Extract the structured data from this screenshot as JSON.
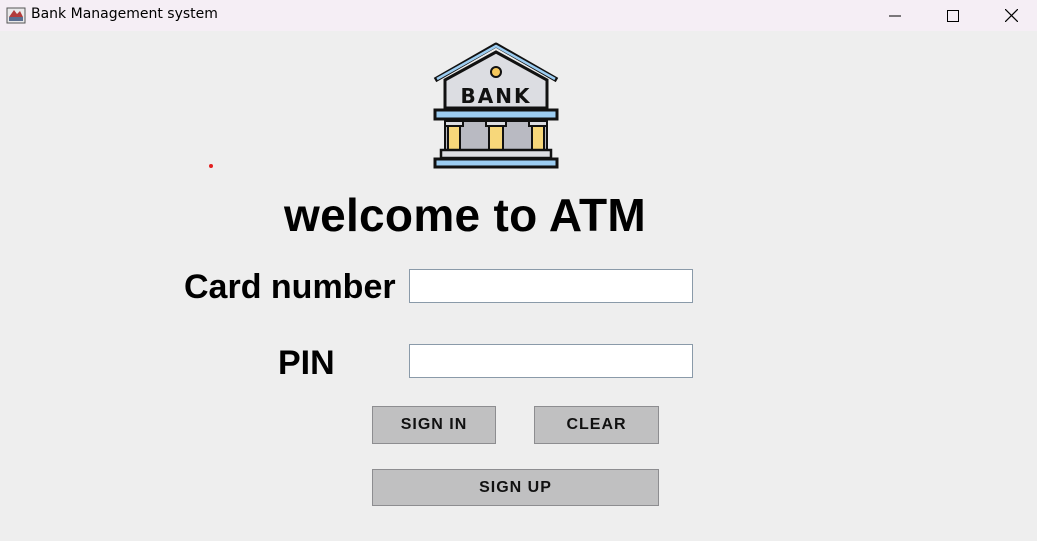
{
  "window": {
    "title": "Bank Management system",
    "controls": {
      "minimize": "minimize-icon",
      "maximize": "maximize-icon",
      "close": "close-icon"
    }
  },
  "logo": {
    "text": "BANK",
    "icon": "bank-building-icon"
  },
  "heading": "welcome to ATM",
  "form": {
    "card_label": "Card number",
    "card_value": "",
    "pin_label": "PIN",
    "pin_value": ""
  },
  "buttons": {
    "sign_in": "SIGN IN",
    "clear": "CLEAR",
    "sign_up": "SIGN UP"
  },
  "colors": {
    "background": "#eeeeee",
    "titlebar": "#f5eef5",
    "button": "#c0c0c1",
    "marker": "#e32020"
  }
}
